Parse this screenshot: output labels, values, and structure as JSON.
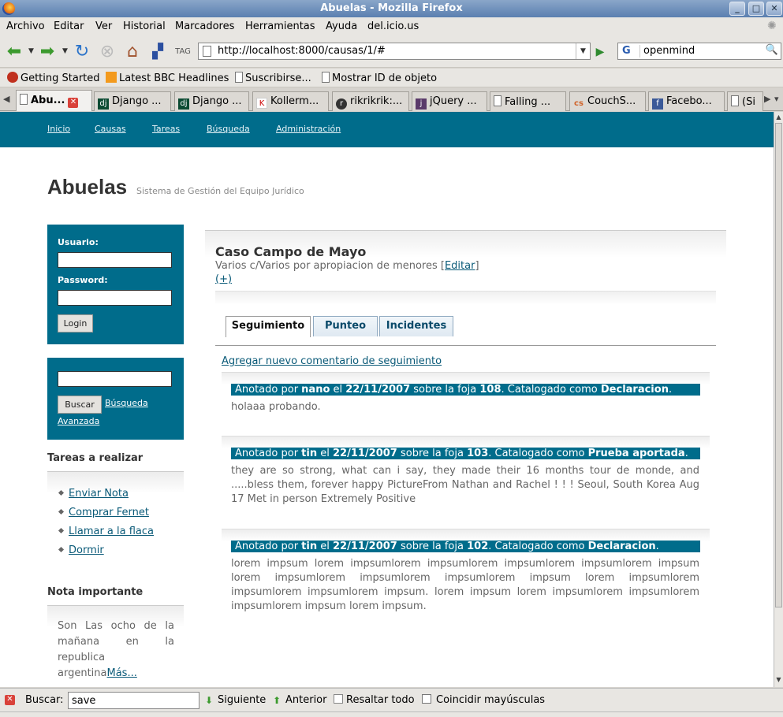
{
  "window": {
    "title": "Abuelas - Mozilla Firefox"
  },
  "menubar": {
    "items": [
      {
        "label": "Archivo"
      },
      {
        "label": "Editar"
      },
      {
        "label": "Ver"
      },
      {
        "label": "Historial"
      },
      {
        "label": "Marcadores"
      },
      {
        "label": "Herramientas"
      },
      {
        "label": "Ayuda"
      },
      {
        "label": "del.icio.us"
      }
    ]
  },
  "navbar": {
    "url": "http://localhost:8000/causas/1/#",
    "search_value": "openmind",
    "search_engine": "G"
  },
  "bookmarks": [
    {
      "label": "Getting Started"
    },
    {
      "label": "Latest BBC Headlines"
    },
    {
      "label": "Suscribirse..."
    },
    {
      "label": "Mostrar ID de objeto"
    }
  ],
  "tabs": [
    {
      "label": "Abu...",
      "active": true
    },
    {
      "label": "Django ..."
    },
    {
      "label": "Django ..."
    },
    {
      "label": "Kollerm..."
    },
    {
      "label": "rikrikrik:..."
    },
    {
      "label": "jQuery ..."
    },
    {
      "label": "Falling ..."
    },
    {
      "label": "CouchS..."
    },
    {
      "label": "Facebo..."
    },
    {
      "label": "(Si"
    }
  ],
  "site": {
    "nav": [
      {
        "label": "Inicio"
      },
      {
        "label": "Causas"
      },
      {
        "label": "Tareas"
      },
      {
        "label": "Búsqueda"
      },
      {
        "label": "Administración"
      }
    ],
    "title": "Abuelas",
    "subtitle": "Sistema de Gestión del Equipo Jurídico",
    "accent_color": "#006c8b"
  },
  "login": {
    "user_label": "Usuario:",
    "password_label": "Password:",
    "button": "Login"
  },
  "search": {
    "button": "Buscar",
    "advanced_link_1": "Búsqueda",
    "advanced_link_2": "Avanzada"
  },
  "tasks": {
    "heading": "Tareas a realizar",
    "items": [
      {
        "label": "Enviar Nota"
      },
      {
        "label": "Comprar Fernet"
      },
      {
        "label": "Llamar a la flaca"
      },
      {
        "label": "Dormir"
      }
    ]
  },
  "note": {
    "heading": "Nota importante",
    "text": "Son Las ocho de la mañana en la republica argentina",
    "more": "Más..."
  },
  "case": {
    "title": "Caso Campo de Mayo",
    "description": "Varios c/Varios por apropiacion de menores [",
    "edit_link": "Editar",
    "description_end": "]",
    "plus_link": "(+)"
  },
  "case_tabs": [
    {
      "label": "Seguimiento",
      "selected": true
    },
    {
      "label": "Punteo"
    },
    {
      "label": "Incidentes"
    }
  ],
  "add_comment": "Agregar nuevo comentario de seguimiento",
  "entries": [
    {
      "prefix": "Anotado por ",
      "author": "nano",
      "mid1": " el ",
      "date": "22/11/2007",
      "mid2": " sobre la foja ",
      "foja": "108",
      "mid3": ". Catalogado como ",
      "category": "Declaracion",
      "suffix": ".",
      "body": "holaaa probando."
    },
    {
      "prefix": "Anotado por ",
      "author": "tin",
      "mid1": " el ",
      "date": "22/11/2007",
      "mid2": " sobre la foja ",
      "foja": "103",
      "mid3": ". Catalogado como ",
      "category": "Prueba aportada",
      "suffix": ".",
      "body": "they are so strong, what can i say, they made their 16 months tour de monde, and .....bless them, forever happy PictureFrom Nathan and Rachel ! ! ! Seoul, South Korea Aug 17 Met in person Extremely Positive"
    },
    {
      "prefix": "Anotado por ",
      "author": "tin",
      "mid1": " el ",
      "date": "22/11/2007",
      "mid2": " sobre la foja ",
      "foja": "102",
      "mid3": ". Catalogado como ",
      "category": "Declaracion",
      "suffix": ".",
      "body": "lorem impsum lorem impsumlorem impsumlorem impsumlorem impsumlorem impsum lorem impsumlorem impsumlorem impsumlorem impsum lorem impsumlorem impsumlorem impsumlorem impsum. lorem impsum lorem impsumlorem impsumlorem impsumlorem impsum lorem impsum."
    }
  ],
  "findbar": {
    "label": "Buscar:",
    "value": "save",
    "next": "Siguiente",
    "prev": "Anterior",
    "highlight": "Resaltar todo",
    "match_case": "Coincidir mayúsculas"
  }
}
